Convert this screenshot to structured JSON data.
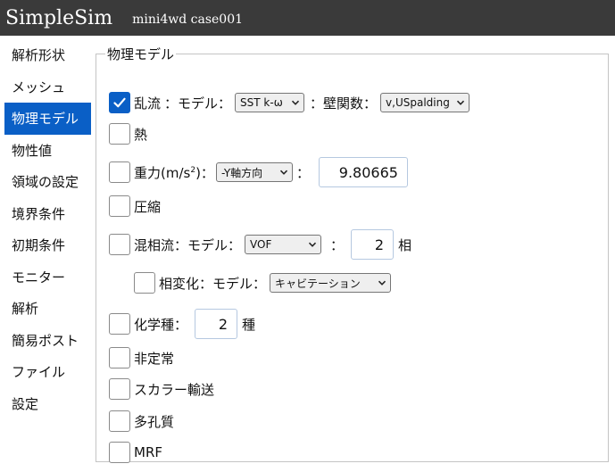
{
  "header": {
    "app_title": "SimpleSim",
    "case_name": "mini4wd case001"
  },
  "sidebar": {
    "items": [
      {
        "label": "解析形状"
      },
      {
        "label": "メッシュ"
      },
      {
        "label": "物理モデル"
      },
      {
        "label": "物性値"
      },
      {
        "label": "領域の設定"
      },
      {
        "label": "境界条件"
      },
      {
        "label": "初期条件"
      },
      {
        "label": "モニター"
      },
      {
        "label": "解析"
      },
      {
        "label": "簡易ポスト"
      },
      {
        "label": "ファイル"
      },
      {
        "label": "設定"
      }
    ],
    "active": "物理モデル"
  },
  "panel": {
    "legend": "物理モデル",
    "turbulence": {
      "checked": true,
      "label": "乱流",
      "model_label": "：モデル：",
      "model_value": "SST k-ω",
      "wall_label": "：壁関数：",
      "wall_value": "v,USpalding"
    },
    "heat": {
      "checked": false,
      "label": "熱"
    },
    "gravity": {
      "checked": false,
      "label_main": "重力(m/s",
      "label_sup": "2",
      "label_tail": ")：",
      "direction_value": "-Y軸方向",
      "colon": "：",
      "value": "9.80665"
    },
    "compressible": {
      "checked": false,
      "label": "圧縮"
    },
    "multiphase": {
      "checked": false,
      "label": "混相流：モデル：",
      "model_value": "VOF",
      "colon": "：",
      "phase_count": "2",
      "unit": "相"
    },
    "phase_change": {
      "checked": false,
      "label": "相変化：モデル：",
      "model_value": "キャビテーション"
    },
    "species": {
      "checked": false,
      "label": "化学種：",
      "count": "2",
      "unit": "種"
    },
    "transient": {
      "checked": false,
      "label": "非定常"
    },
    "scalar": {
      "checked": false,
      "label": "スカラー輸送"
    },
    "porous": {
      "checked": false,
      "label": "多孔質"
    },
    "mrf": {
      "checked": false,
      "label": "MRF"
    }
  },
  "colors": {
    "header_bg": "#3a3a3a",
    "accent": "#0a5fc6"
  }
}
